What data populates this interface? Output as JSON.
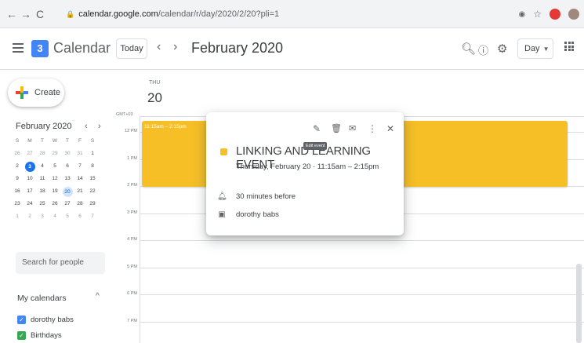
{
  "browser": {
    "url_host": "calendar.google.com",
    "url_path": "/calendar/r/day/2020/2/20?pli=1"
  },
  "header": {
    "app_title": "Calendar",
    "logo_day": "3",
    "today_label": "Today",
    "date_title": "February 2020",
    "view_label": "Day"
  },
  "sidebar": {
    "create_label": "Create",
    "month_label": "February 2020",
    "mini_calendar": {
      "days_of_week": [
        "S",
        "M",
        "T",
        "W",
        "T",
        "F",
        "S"
      ],
      "weeks": [
        [
          "26",
          "27",
          "28",
          "29",
          "30",
          "31",
          "1"
        ],
        [
          "2",
          "3",
          "4",
          "5",
          "6",
          "7",
          "8"
        ],
        [
          "9",
          "10",
          "11",
          "12",
          "13",
          "14",
          "15"
        ],
        [
          "16",
          "17",
          "18",
          "19",
          "20",
          "21",
          "22"
        ],
        [
          "23",
          "24",
          "25",
          "26",
          "27",
          "28",
          "29"
        ],
        [
          "1",
          "2",
          "3",
          "4",
          "5",
          "6",
          "7"
        ]
      ],
      "today": "3",
      "selected": "20"
    },
    "search_people_placeholder": "Search for people",
    "my_calendars_label": "My calendars",
    "calendars": [
      {
        "name": "dorothy babs",
        "color": "#4285f4"
      },
      {
        "name": "Birthdays",
        "color": "#34a853"
      }
    ]
  },
  "day_view": {
    "dow": "THU",
    "day_number": "20",
    "timezone": "GMT+03",
    "hours": [
      "12 PM",
      "1 PM",
      "2 PM",
      "3 PM",
      "4 PM",
      "5 PM",
      "6 PM",
      "7 PM",
      "8 PM"
    ]
  },
  "event": {
    "time_label": "11:15am – 2:15pm",
    "color": "#f6bf26"
  },
  "popup": {
    "title": "LINKING AND LEARNING EVENT",
    "when": "Thursday, February 20  ·  11:15am – 2:15pm",
    "tooltip": "Edit event",
    "reminder": "30 minutes before",
    "calendar_owner": "dorothy babs"
  },
  "colors": {
    "accent": "#1a73e8",
    "event_yellow": "#f6bf26"
  }
}
